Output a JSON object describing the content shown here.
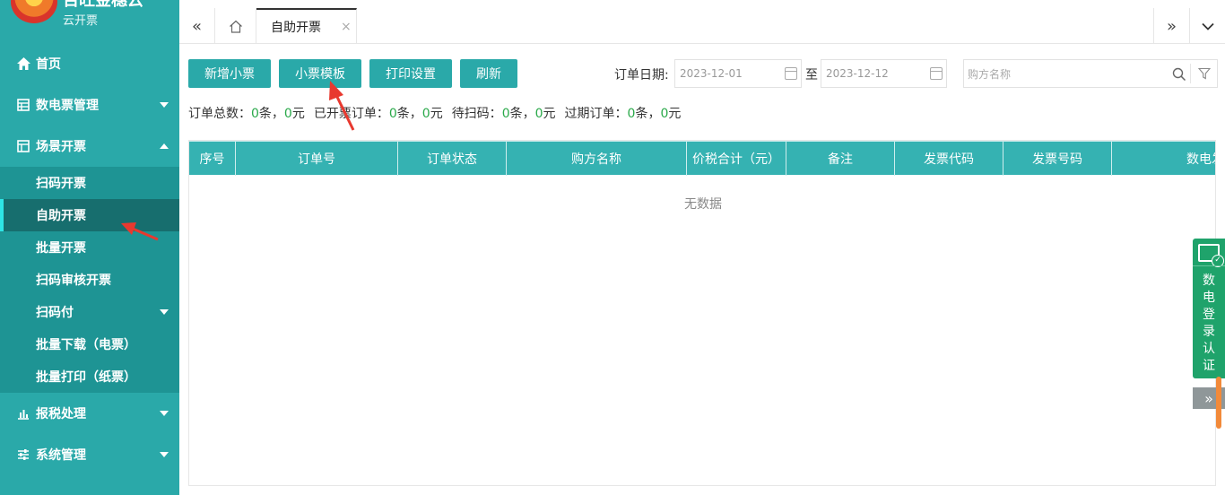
{
  "app": {
    "logo_name": "百旺金穗云",
    "logo_sub": "云开票"
  },
  "sidebar": {
    "home": "首页",
    "digital": "数电票管理",
    "scene": "场景开票",
    "scene_items": [
      "扫码开票",
      "自助开票",
      "批量开票",
      "扫码审核开票",
      "扫码付",
      "批量下载（电票）",
      "批量打印（纸票）"
    ],
    "tax": "报税处理",
    "system": "系统管理"
  },
  "tabs": {
    "prev": "«",
    "next": "»",
    "active": "自助开票",
    "close": "×"
  },
  "toolbar": {
    "add": "新增小票",
    "template": "小票模板",
    "print": "打印设置",
    "refresh": "刷新",
    "date_label": "订单日期:",
    "date_from": "2023-12-01",
    "date_sep": "至",
    "date_to": "2023-12-12",
    "search_placeholder": "购方名称"
  },
  "summary": {
    "total_label": "订单总数：",
    "total_count": "0",
    "total_unit": "条，",
    "total_amount": "0",
    "amount_unit": "元",
    "issued_label": "已开票订单：",
    "issued_count": "0",
    "issued_amount": "0",
    "pending_label": "待扫码：",
    "pending_count": "0",
    "pending_amount": "0",
    "expired_label": "过期订单：",
    "expired_count": "0",
    "expired_amount": "0"
  },
  "table": {
    "columns": [
      "序号",
      "订单号",
      "订单状态",
      "购方名称",
      "价税合计（元）",
      "备注",
      "发票代码",
      "发票号码",
      "数电发票"
    ],
    "empty_text": "无数据"
  },
  "widget": {
    "text": "数电登录认证",
    "collapse": "»"
  },
  "colors": {
    "primary": "#2aa9a9",
    "header": "#35b2b2",
    "active_menu": "#176e6e",
    "widget": "#1fa36b",
    "number": "#2aa94a"
  }
}
